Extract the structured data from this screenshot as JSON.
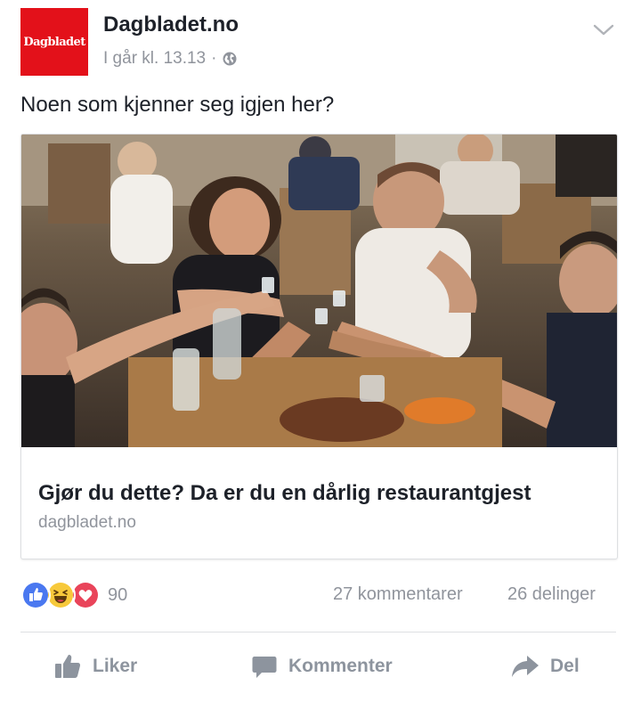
{
  "header": {
    "logo_text": "Dagbladet",
    "page_name": "Dagbladet.no",
    "timestamp": "I går kl. 13.13",
    "separator": "·",
    "audience_icon": "globe-icon",
    "menu_icon": "chevron-down-icon"
  },
  "post": {
    "text": "Noen som kjenner seg igjen her?"
  },
  "link_card": {
    "image_icon": "photo-people-toasting-in-restaurant",
    "title": "Gjør du dette? Da er du en dårlig restaurantgjest",
    "domain": "dagbladet.no"
  },
  "engagement": {
    "reaction_icons": [
      "like-icon",
      "haha-icon",
      "love-icon"
    ],
    "reaction_count": "90",
    "comments": "27 kommentarer",
    "shares": "26 delinger"
  },
  "actions": {
    "like": "Liker",
    "comment": "Kommenter",
    "share": "Del"
  },
  "colors": {
    "brand_red": "#e3111a",
    "like_blue": "#4a78f0",
    "haha_yellow": "#f7c93b",
    "love_red": "#e9445a",
    "muted_text": "#90949c"
  }
}
